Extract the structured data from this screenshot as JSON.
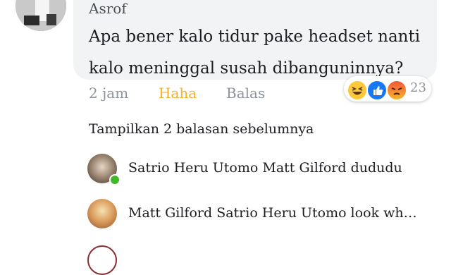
{
  "comment": {
    "author": "Asrof",
    "text": "Apa bener kalo tidur pake headset nanti kalo meninggal susah dibanguninnya?",
    "time": "2 jam",
    "my_reaction": "Haha",
    "reply_label": "Balas",
    "reactions": {
      "icons": [
        "haha-icon",
        "like-icon",
        "angry-icon"
      ],
      "count": "23"
    }
  },
  "show_previous": "Tampilkan 2 balasan sebelumnya",
  "replies": [
    {
      "author": "Satrio Heru Utomo",
      "text": "Matt Gilford dududu",
      "online": true
    },
    {
      "author": "Matt Gilford",
      "text": "Satrio Heru Utomo look wh…",
      "online": false
    }
  ],
  "colors": {
    "haha": "#f7b125",
    "like": "#1877f2",
    "online": "#42b72a",
    "bubble": "#f2f3f5"
  }
}
